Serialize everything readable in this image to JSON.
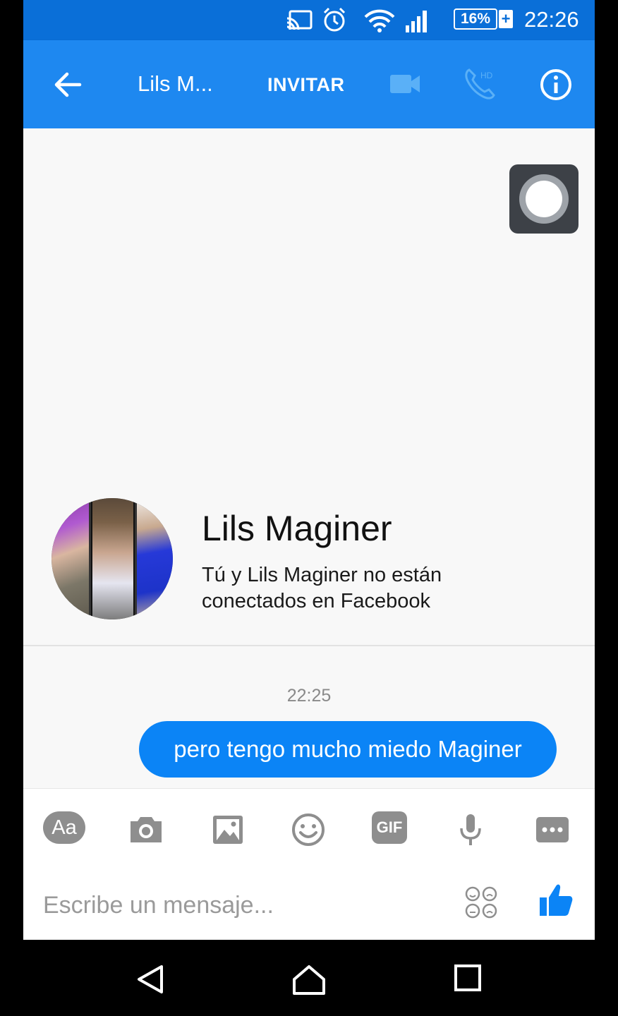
{
  "status_bar": {
    "battery": "16%",
    "battery_plus": "+",
    "time": "22:26"
  },
  "header": {
    "title": "Lils M...",
    "invite_label": "INVITAR"
  },
  "contact": {
    "name": "Lils Maginer",
    "note": "Tú y Lils Maginer no están conectados en Facebook"
  },
  "messages": [
    {
      "timestamp": "22:25",
      "text": "pero tengo mucho miedo Maginer",
      "sender": "me"
    }
  ],
  "composer": {
    "aa_label": "Aa",
    "gif_label": "GIF",
    "placeholder": "Escribe un mensaje..."
  },
  "colors": {
    "header": "#1e88f0",
    "status_bar": "#0a6fd8",
    "bubble": "#0b84f6",
    "icon_gray": "#8e8e8e"
  }
}
